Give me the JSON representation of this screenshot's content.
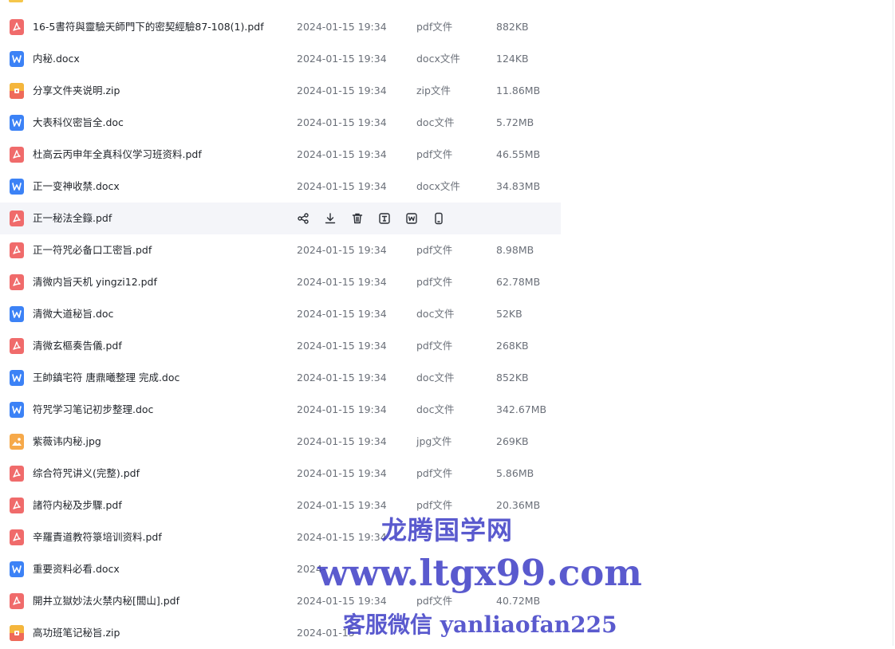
{
  "files": [
    {
      "name": "16-5書符與靈驗天師門下的密契經驗87-108(1).pdf",
      "date": "2024-01-15 19:34",
      "type": "pdf文件",
      "size": "882KB",
      "icon": "pdf-icon"
    },
    {
      "name": "内秘.docx",
      "date": "2024-01-15 19:34",
      "type": "docx文件",
      "size": "124KB",
      "icon": "word-icon"
    },
    {
      "name": "分享文件夹说明.zip",
      "date": "2024-01-15 19:34",
      "type": "zip文件",
      "size": "11.86MB",
      "icon": "zip-icon"
    },
    {
      "name": "大表科仪密旨全.doc",
      "date": "2024-01-15 19:34",
      "type": "doc文件",
      "size": "5.72MB",
      "icon": "word-icon"
    },
    {
      "name": "杜高云丙申年全真科仪学习班资料.pdf",
      "date": "2024-01-15 19:34",
      "type": "pdf文件",
      "size": "46.55MB",
      "icon": "pdf-icon"
    },
    {
      "name": "正一变神收禁.docx",
      "date": "2024-01-15 19:34",
      "type": "docx文件",
      "size": "34.83MB",
      "icon": "word-icon"
    },
    {
      "name": "正一秘法全籙.pdf",
      "date": "",
      "type": "",
      "size": "",
      "icon": "pdf-icon",
      "hovered": true
    },
    {
      "name": "正一符咒必备口工密旨.pdf",
      "date": "2024-01-15 19:34",
      "type": "pdf文件",
      "size": "8.98MB",
      "icon": "pdf-icon"
    },
    {
      "name": "清微内旨天机 yingzi12.pdf",
      "date": "2024-01-15 19:34",
      "type": "pdf文件",
      "size": "62.78MB",
      "icon": "pdf-icon"
    },
    {
      "name": "清微大道秘旨.doc",
      "date": "2024-01-15 19:34",
      "type": "doc文件",
      "size": "52KB",
      "icon": "word-icon"
    },
    {
      "name": "清微玄樞奏告儀.pdf",
      "date": "2024-01-15 19:34",
      "type": "pdf文件",
      "size": "268KB",
      "icon": "pdf-icon"
    },
    {
      "name": "王帥鎮宅符  唐鼎曦整理  完成.doc",
      "date": "2024-01-15 19:34",
      "type": "doc文件",
      "size": "852KB",
      "icon": "word-icon"
    },
    {
      "name": "符咒学习笔记初步整理.doc",
      "date": "2024-01-15 19:34",
      "type": "doc文件",
      "size": "342.67MB",
      "icon": "word-icon"
    },
    {
      "name": "紫薇讳内秘.jpg",
      "date": "2024-01-15 19:34",
      "type": "jpg文件",
      "size": "269KB",
      "icon": "image-icon"
    },
    {
      "name": "综合符咒讲义(完整).pdf",
      "date": "2024-01-15 19:34",
      "type": "pdf文件",
      "size": "5.86MB",
      "icon": "pdf-icon"
    },
    {
      "name": "諸符内秘及步驟.pdf",
      "date": "2024-01-15 19:34",
      "type": "pdf文件",
      "size": "20.36MB",
      "icon": "pdf-icon"
    },
    {
      "name": "辛羅責道教符箓培训资料.pdf",
      "date": "2024-01-15 19:34",
      "type": "",
      "size": "",
      "icon": "pdf-icon"
    },
    {
      "name": "重要资料必看.docx",
      "date": "2024-",
      "type": "",
      "size": "",
      "icon": "word-icon"
    },
    {
      "name": "開井立獄妙法火禁内秘[閭山].pdf",
      "date": "2024-01-15 19:34",
      "type": "pdf文件",
      "size": "40.72MB",
      "icon": "pdf-icon"
    },
    {
      "name": "高功班笔记秘旨.zip",
      "date": "2024-01-15",
      "type": "",
      "size": "",
      "icon": "zip-icon"
    }
  ],
  "hover_actions": [
    {
      "name": "share-icon"
    },
    {
      "name": "download-icon"
    },
    {
      "name": "delete-icon"
    },
    {
      "name": "text-extract-icon"
    },
    {
      "name": "word-convert-icon"
    },
    {
      "name": "phone-icon"
    }
  ],
  "watermark": {
    "line1": "龙腾国学网",
    "line2": "www.ltgx99.com",
    "line3": "客服微信 yanliaofan225"
  },
  "colors": {
    "pdf": "#f06b6b",
    "word": "#3c82f6",
    "zip_top": "#f5b63c",
    "zip_bottom": "#ef6a5a",
    "image": "#f6a94a",
    "hover_row": "#f4f5f9",
    "watermark": "#3e3ec6"
  }
}
